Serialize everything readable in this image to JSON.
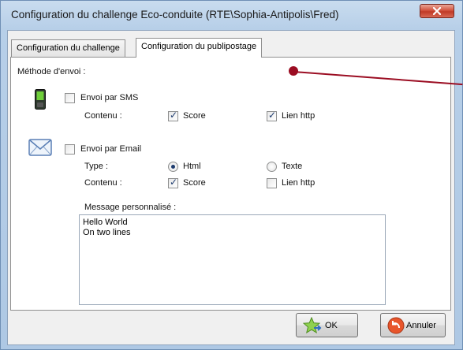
{
  "window": {
    "title": "Configuration du challenge Eco-conduite (RTE\\Sophia-Antipolis\\Fred)"
  },
  "tabs": [
    {
      "label": "Configuration du challenge",
      "active": false
    },
    {
      "label": "Configuration du publipostage",
      "active": true
    }
  ],
  "form": {
    "method_label": "Méthode d'envoi :",
    "sms": {
      "label": "Envoi par SMS",
      "checked": false,
      "icon": "mobile-phone-icon",
      "content_label": "Contenu :",
      "score": {
        "label": "Score",
        "checked": true
      },
      "link": {
        "label": "Lien http",
        "checked": true
      }
    },
    "email": {
      "label": "Envoi par Email",
      "checked": false,
      "icon": "envelope-icon",
      "type_label": "Type :",
      "html": {
        "label": "Html",
        "selected": true
      },
      "text": {
        "label": "Texte",
        "selected": false
      },
      "content_label": "Contenu :",
      "score": {
        "label": "Score",
        "checked": true
      },
      "link": {
        "label": "Lien http",
        "checked": false
      }
    },
    "message_label": "Message personnalisé :",
    "message_value": "Hello World\nOn two lines"
  },
  "buttons": {
    "ok": {
      "label": "OK",
      "icon": "star-arrow-icon"
    },
    "cancel": {
      "label": "Annuler",
      "icon": "cancel-arrow-icon"
    }
  },
  "colors": {
    "accent_pointer": "#9b0d22",
    "close_button": "#c8452f",
    "checkmark": "#1d3b6e"
  }
}
